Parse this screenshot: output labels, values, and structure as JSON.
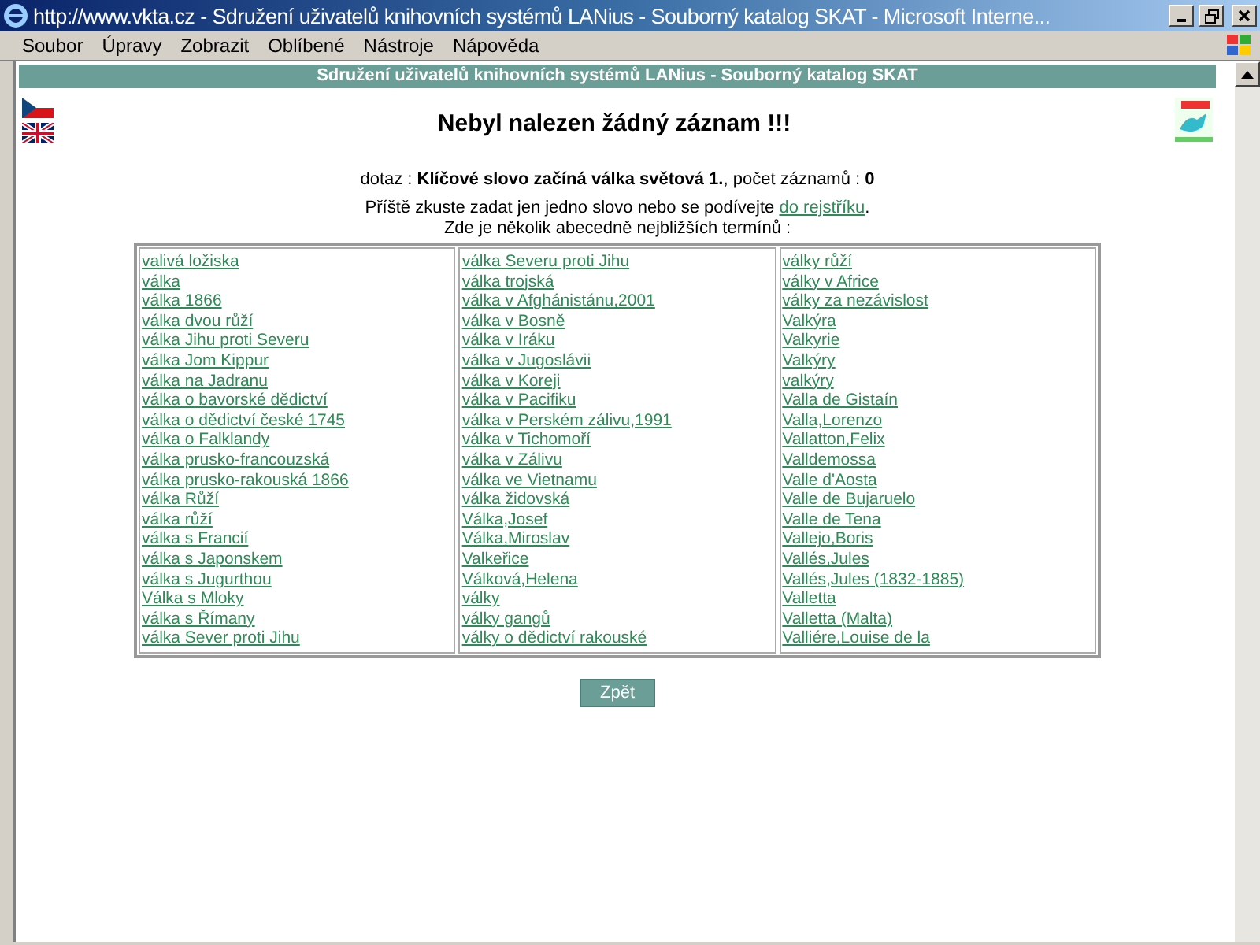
{
  "window": {
    "title": "http://www.vkta.cz - Sdružení uživatelů knihovních systémů LANius - Souborný katalog SKAT - Microsoft Interne..."
  },
  "menu": [
    "Soubor",
    "Úpravy",
    "Zobrazit",
    "Oblíbené",
    "Nástroje",
    "Nápověda"
  ],
  "header": "Sdružení uživatelů knihovních systémů LANius - Souborný katalog SKAT",
  "heading": "Nebyl nalezen žádný záznam !!!",
  "query": "dotaz : **Klíčové slovo začíná válka světová 1.**, počet záznamů : **0**",
  "hint": {
    "text": "Příště zkuste zadat jen jedno slovo nebo se podívejte",
    "link": "do rejstříku",
    "after": "."
  },
  "nearest_label": "Zde je několik abecedně nejbližších termínů :",
  "terms": [
    {
      "items": [
        "valivá ložiska",
        "válka",
        "válka 1866",
        "válka dvou růží",
        "válka Jihu proti Severu",
        "válka Jom Kippur",
        "válka na Jadranu",
        "válka o bavorské dědictví",
        "válka o dědictví české 1745",
        "válka o Falklandy",
        "válka prusko-francouzská",
        "válka prusko-rakouská 1866",
        "válka Růží",
        "válka růží",
        "válka s Francií",
        "válka s Japonskem",
        "válka s Jugurthou",
        "Válka s Mloky",
        "válka s Římany",
        "válka Sever proti Jihu"
      ]
    },
    {
      "items": [
        "válka Severu proti Jihu",
        "válka trojská",
        "válka v Afghánistánu,2001",
        "válka v Bosně",
        "válka v Iráku",
        "válka v Jugoslávii",
        "válka v Koreji",
        "válka v Pacifiku",
        "válka v Perském zálivu,1991",
        "válka v Tichomoří",
        "válka v Zálivu",
        "válka ve Vietnamu",
        "válka židovská",
        "Válka,Josef",
        "Válka,Miroslav",
        "Valkeřice",
        "Válková,Helena",
        "války",
        "války gangů",
        "války o dědictví rakouské"
      ]
    },
    {
      "items": [
        "války růží",
        "války v Africe",
        "války za nezávislost",
        "Valkýra",
        "Valkyrie",
        "Valkýry",
        "valkýry",
        "Valla de Gistaín",
        "Valla,Lorenzo",
        "Vallatton,Felix",
        "Valldemossa",
        "Valle d'Aosta",
        "Valle de Bujaruelo",
        "Valle de Tena",
        "Vallejo,Boris",
        "Vallés,Jules",
        "Vallés,Jules (1832-1885)",
        "Valletta",
        "Valletta (Malta)",
        "Valliére,Louise de la"
      ]
    }
  ],
  "back_button": "Zpět"
}
